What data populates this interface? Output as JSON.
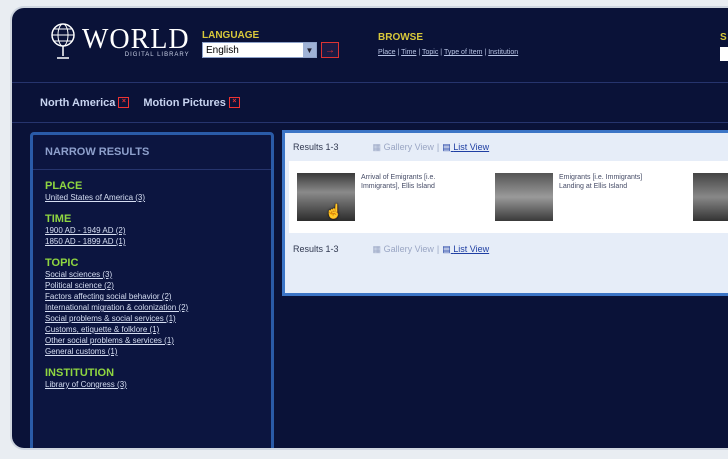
{
  "header": {
    "logo_title": "WORLD",
    "logo_subtitle": "DIGITAL LIBRARY",
    "language_label": "LANGUAGE",
    "language_value": "English",
    "browse_label": "BROWSE",
    "browse_links": [
      "Place",
      "Time",
      "Topic",
      "Type of Item",
      "Institution"
    ],
    "search_label": "S"
  },
  "breadcrumbs": [
    "North America",
    "Motion Pictures"
  ],
  "sidebar": {
    "title": "NARROW RESULTS",
    "facets": [
      {
        "title": "PLACE",
        "links": [
          "United States of America (3)"
        ]
      },
      {
        "title": "TIME",
        "links": [
          "1900 AD - 1949 AD (2)",
          "1850 AD - 1899 AD (1)"
        ]
      },
      {
        "title": "TOPIC",
        "links": [
          "Social sciences (3)",
          "Political science (2)",
          "Factors affecting social behavior (2)",
          "International migration & colonization (2)",
          "Social problems & social services (1)",
          "Customs, etiquette & folklore (1)",
          "Other social problems & services (1)",
          "General customs (1)"
        ]
      },
      {
        "title": "INSTITUTION",
        "links": [
          "Library of Congress (3)"
        ]
      }
    ]
  },
  "results": {
    "count_label": "Results 1-3",
    "gallery_view": "Gallery View",
    "separator": "|",
    "list_view": "List View",
    "items": [
      {
        "title": "Arrival of Emigrants [i.e. Immigrants], Ellis Island"
      },
      {
        "title": "Emigrants [i.e. Immigrants] Landing at Ellis Island"
      }
    ]
  },
  "colors": {
    "background": "#0a1238",
    "facet_title": "#8fd640",
    "label_yellow": "#d8c83a",
    "accent_red": "#e33333",
    "panel_border": "#3c75c6"
  }
}
